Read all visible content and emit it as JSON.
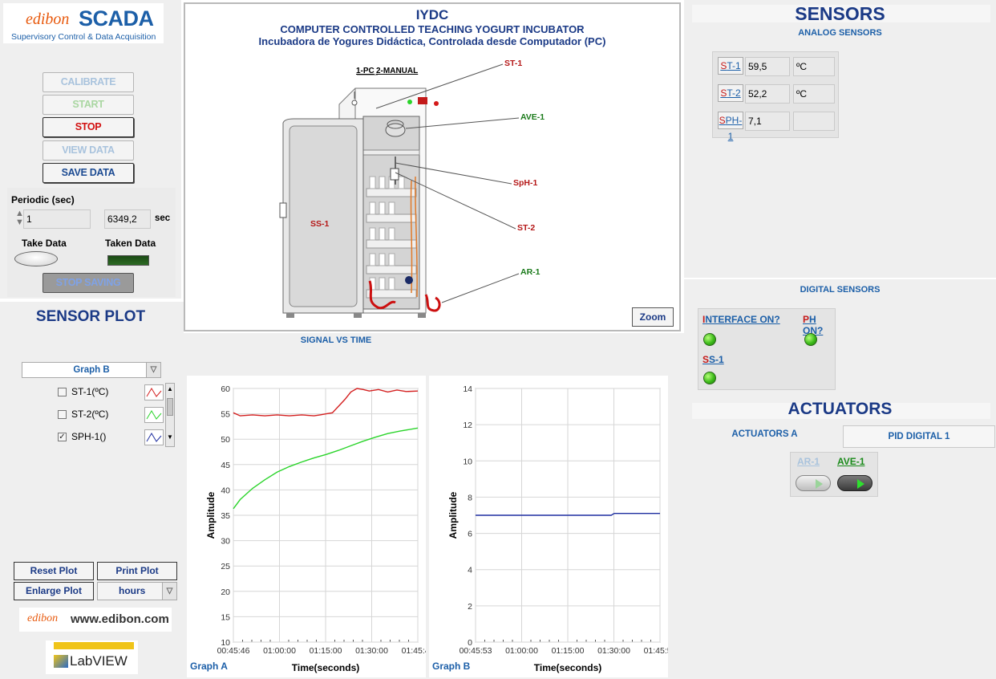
{
  "brand": {
    "logo_text": "edibon",
    "scada": "SCADA",
    "tagline": "Supervisory Control & Data Acquisition"
  },
  "controls": {
    "calibrate": "CALIBRATE",
    "start": "START",
    "stop": "STOP",
    "view_data": "VIEW DATA",
    "save_data": "SAVE DATA",
    "periodic_label": "Periodic (sec)",
    "periodic_value": "1",
    "elapsed_value": "6349,2",
    "elapsed_unit": "sec",
    "take_data": "Take Data",
    "taken_data": "Taken Data",
    "stop_saving": "STOP SAVING"
  },
  "diagram": {
    "title": "IYDC",
    "subtitle": "COMPUTER CONTROLLED TEACHING YOGURT INCUBATOR",
    "subtitle_es": "Incubadora de Yogures Didáctica, Controlada desde Computador (PC)",
    "switch_pc": "1-PC",
    "switch_manual": "2-MANUAL",
    "labels": {
      "st1": "ST-1",
      "ave1": "AVE-1",
      "sph1": "SpH-1",
      "st2": "ST-2",
      "ar1": "AR-1",
      "ss1": "SS-1"
    },
    "zoom": "Zoom"
  },
  "sensors": {
    "title": "SENSORS",
    "analog_title": "ANALOG SENSORS",
    "analog": [
      {
        "tag_first": "S",
        "tag_rest": "T-1",
        "value": "59,5",
        "unit": "ºC"
      },
      {
        "tag_first": "S",
        "tag_rest": "T-2",
        "value": "52,2",
        "unit": "ºC"
      },
      {
        "tag_first": "S",
        "tag_rest": "PH-1",
        "value": "7,1",
        "unit": ""
      }
    ],
    "digital_title": "DIGITAL SENSORS",
    "digital": [
      {
        "first": "I",
        "rest": "NTERFACE ON?"
      },
      {
        "first": "P",
        "rest": "H ON?"
      },
      {
        "first": "S",
        "rest": "S-1"
      }
    ]
  },
  "actuators": {
    "title": "ACTUATORS",
    "tab_a": "ACTUATORS A",
    "tab_pid": "PID DIGITAL 1",
    "ar1": "AR-1",
    "ave1": "AVE-1"
  },
  "plot": {
    "sensor_plot_title": "SENSOR PLOT",
    "signal_title": "SIGNAL VS TIME",
    "graph_select": "Graph B",
    "legend": [
      {
        "label": "ST-1(ºC)",
        "checked": false,
        "color": "#d42020"
      },
      {
        "label": "ST-2(ºC)",
        "checked": false,
        "color": "#2bd42b"
      },
      {
        "label": "SPH-1()",
        "checked": true,
        "color": "#1f2fa0"
      }
    ],
    "reset_plot": "Reset Plot",
    "print_plot": "Print Plot",
    "enlarge_plot": "Enlarge Plot",
    "units_select": "hours",
    "website": "www.edibon.com",
    "labview": "LabVIEW",
    "graph_a_label": "Graph A",
    "graph_b_label": "Graph B"
  },
  "chart_data": [
    {
      "type": "line",
      "title": "",
      "xlabel": "Time(seconds)",
      "ylabel": "Amplitude",
      "ylim": [
        10,
        60
      ],
      "yticks": [
        "10",
        "15",
        "20",
        "25",
        "30",
        "35",
        "40",
        "45",
        "50",
        "55",
        "60"
      ],
      "xticks": [
        "00:45:46",
        "01:00:00",
        "01:15:00",
        "01:30:00",
        "01:45:46"
      ],
      "xlim_min": [
        45.77,
        105.77
      ],
      "grid": true,
      "series": [
        {
          "color": "#d42020",
          "x": [
            45.77,
            48,
            52,
            56,
            60,
            64,
            68,
            72,
            74,
            76,
            78,
            80,
            82,
            84,
            86,
            88,
            90,
            93,
            96,
            99,
            102,
            105.77
          ],
          "y": [
            55.2,
            54.6,
            54.8,
            54.6,
            54.8,
            54.6,
            54.8,
            54.6,
            54.8,
            55,
            55.2,
            56.5,
            57.8,
            59.3,
            60,
            59.8,
            59.5,
            59.8,
            59.3,
            59.7,
            59.4,
            59.5
          ]
        },
        {
          "color": "#2bd42b",
          "x": [
            45.77,
            48,
            52,
            56,
            60,
            64,
            68,
            72,
            76,
            80,
            84,
            88,
            92,
            96,
            100,
            105.77
          ],
          "y": [
            36.3,
            38.1,
            40.3,
            42,
            43.5,
            44.6,
            45.5,
            46.3,
            47,
            47.8,
            48.7,
            49.6,
            50.4,
            51.1,
            51.6,
            52.2
          ]
        }
      ]
    },
    {
      "type": "line",
      "title": "",
      "xlabel": "Time(seconds)",
      "ylabel": "Amplitude",
      "ylim": [
        0,
        14
      ],
      "yticks": [
        "0",
        "2",
        "4",
        "6",
        "8",
        "10",
        "12",
        "14"
      ],
      "xticks": [
        "00:45:53",
        "01:00:00",
        "01:15:00",
        "01:30:00",
        "01:45:53"
      ],
      "xlim_min": [
        45.88,
        105.88
      ],
      "grid": true,
      "series": [
        {
          "color": "#1f2fa0",
          "x": [
            45.88,
            60,
            75,
            90,
            91,
            105.88
          ],
          "y": [
            7.0,
            7.0,
            7.0,
            7.0,
            7.1,
            7.1
          ]
        }
      ]
    }
  ]
}
